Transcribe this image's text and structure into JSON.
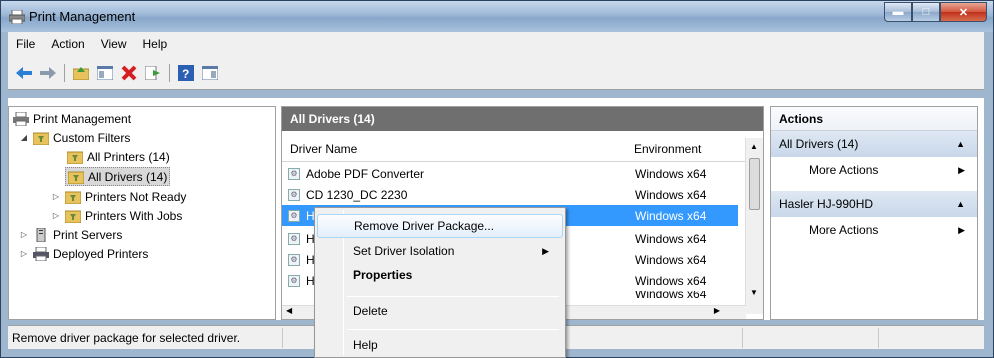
{
  "window": {
    "title": "Print Management"
  },
  "menu": [
    "File",
    "Action",
    "View",
    "Help"
  ],
  "tree": {
    "root": "Print Management",
    "custom_filters": "Custom Filters",
    "all_printers": "All Printers (14)",
    "all_drivers": "All Drivers (14)",
    "printers_not_ready": "Printers Not Ready",
    "printers_with_jobs": "Printers With Jobs",
    "print_servers": "Print Servers",
    "deployed_printers": "Deployed Printers"
  },
  "center": {
    "header": "All Drivers (14)",
    "columns": [
      "Driver Name",
      "Environment"
    ],
    "rows": [
      {
        "name": "Adobe PDF Converter",
        "env": "Windows x64"
      },
      {
        "name": "CD 1230_DC 2230",
        "env": "Windows x64"
      },
      {
        "name": "H",
        "env": "Windows x64"
      },
      {
        "name": "H",
        "env": "Windows x64"
      },
      {
        "name": "H",
        "env": "Windows x64"
      },
      {
        "name": "H",
        "env": "Windows x64"
      },
      {
        "name": "",
        "env": "Windows x64"
      }
    ]
  },
  "actions": {
    "header": "Actions",
    "sec1": "All Drivers (14)",
    "sec1_more": "More Actions",
    "sec2": "Hasler HJ-990HD",
    "sec2_more": "More Actions"
  },
  "context_menu": {
    "items": [
      "Remove Driver Package...",
      "Set Driver Isolation",
      "Properties",
      "Delete",
      "Help"
    ]
  },
  "status": {
    "text": "Remove driver package for selected driver."
  }
}
